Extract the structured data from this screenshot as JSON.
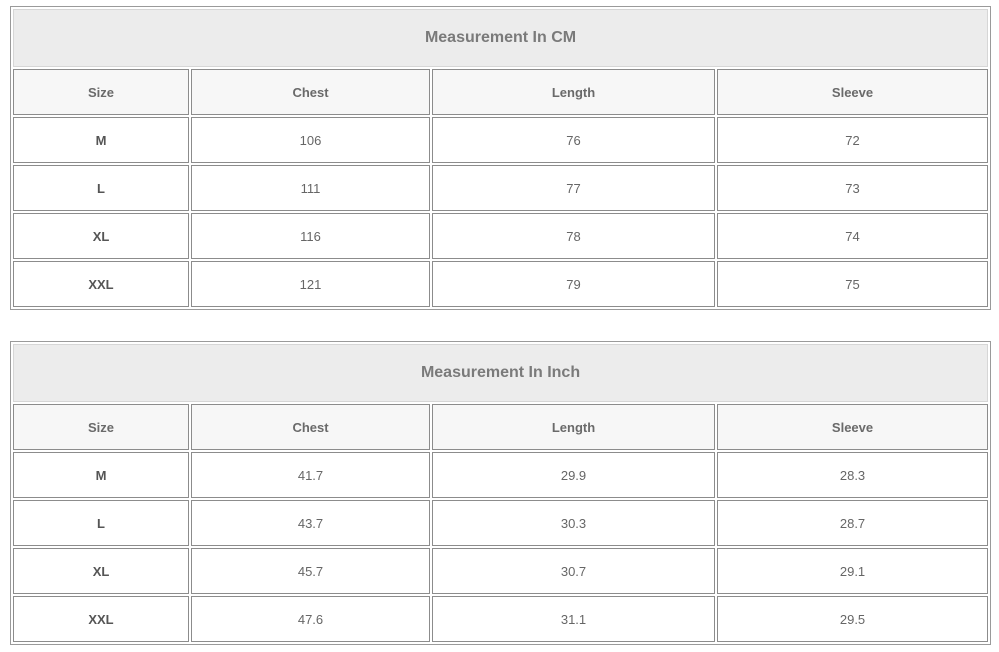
{
  "tables": [
    {
      "title": "Measurement In CM",
      "headers": [
        "Size",
        "Chest",
        "Length",
        "Sleeve"
      ],
      "rows": [
        [
          "M",
          "106",
          "76",
          "72"
        ],
        [
          "L",
          "111",
          "77",
          "73"
        ],
        [
          "XL",
          "116",
          "78",
          "74"
        ],
        [
          "XXL",
          "121",
          "79",
          "75"
        ]
      ]
    },
    {
      "title": "Measurement In Inch",
      "headers": [
        "Size",
        "Chest",
        "Length",
        "Sleeve"
      ],
      "rows": [
        [
          "M",
          "41.7",
          "29.9",
          "28.3"
        ],
        [
          "L",
          "43.7",
          "30.3",
          "28.7"
        ],
        [
          "XL",
          "45.7",
          "30.7",
          "29.1"
        ],
        [
          "XXL",
          "47.6",
          "31.1",
          "29.5"
        ]
      ]
    }
  ]
}
